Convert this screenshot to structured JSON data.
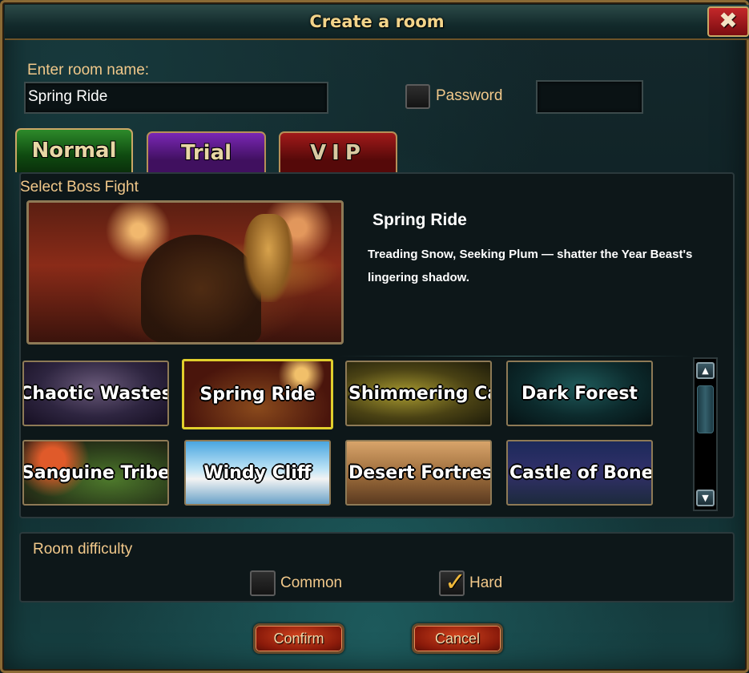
{
  "window": {
    "title": "Create a room",
    "close_label": "✖"
  },
  "room": {
    "name_label": "Enter room name:",
    "name_value": "Spring Ride",
    "password_label": "Password",
    "password_checked": false,
    "password_value": ""
  },
  "tabs": [
    {
      "label": "Normal",
      "active": true
    },
    {
      "label": "Trial",
      "active": false
    },
    {
      "label": "VIP",
      "active": false
    }
  ],
  "boss": {
    "section_label": "Select Boss Fight",
    "selected_name": "Spring Ride",
    "selected_description": "Treading Snow, Seeking Plum — shatter the Year Beast's lingering shadow.",
    "cards": [
      {
        "label": "Chaotic Wastes",
        "selected": false
      },
      {
        "label": "Spring Ride",
        "selected": true
      },
      {
        "label": "Shimmering Ca",
        "selected": false
      },
      {
        "label": "Dark Forest",
        "selected": false
      },
      {
        "label": "Sanguine Tribe",
        "selected": false
      },
      {
        "label": "Windy Cliff",
        "selected": false
      },
      {
        "label": "Desert Fortress",
        "selected": false
      },
      {
        "label": "Castle of Bones",
        "selected": false
      }
    ]
  },
  "scrollbar": {
    "up_icon": "▲",
    "down_icon": "▼"
  },
  "difficulty": {
    "section_label": "Room difficulty",
    "options": [
      {
        "label": "Common",
        "checked": false
      },
      {
        "label": "Hard",
        "checked": true
      }
    ],
    "check_glyph": "✓"
  },
  "buttons": {
    "confirm": "Confirm",
    "cancel": "Cancel"
  }
}
